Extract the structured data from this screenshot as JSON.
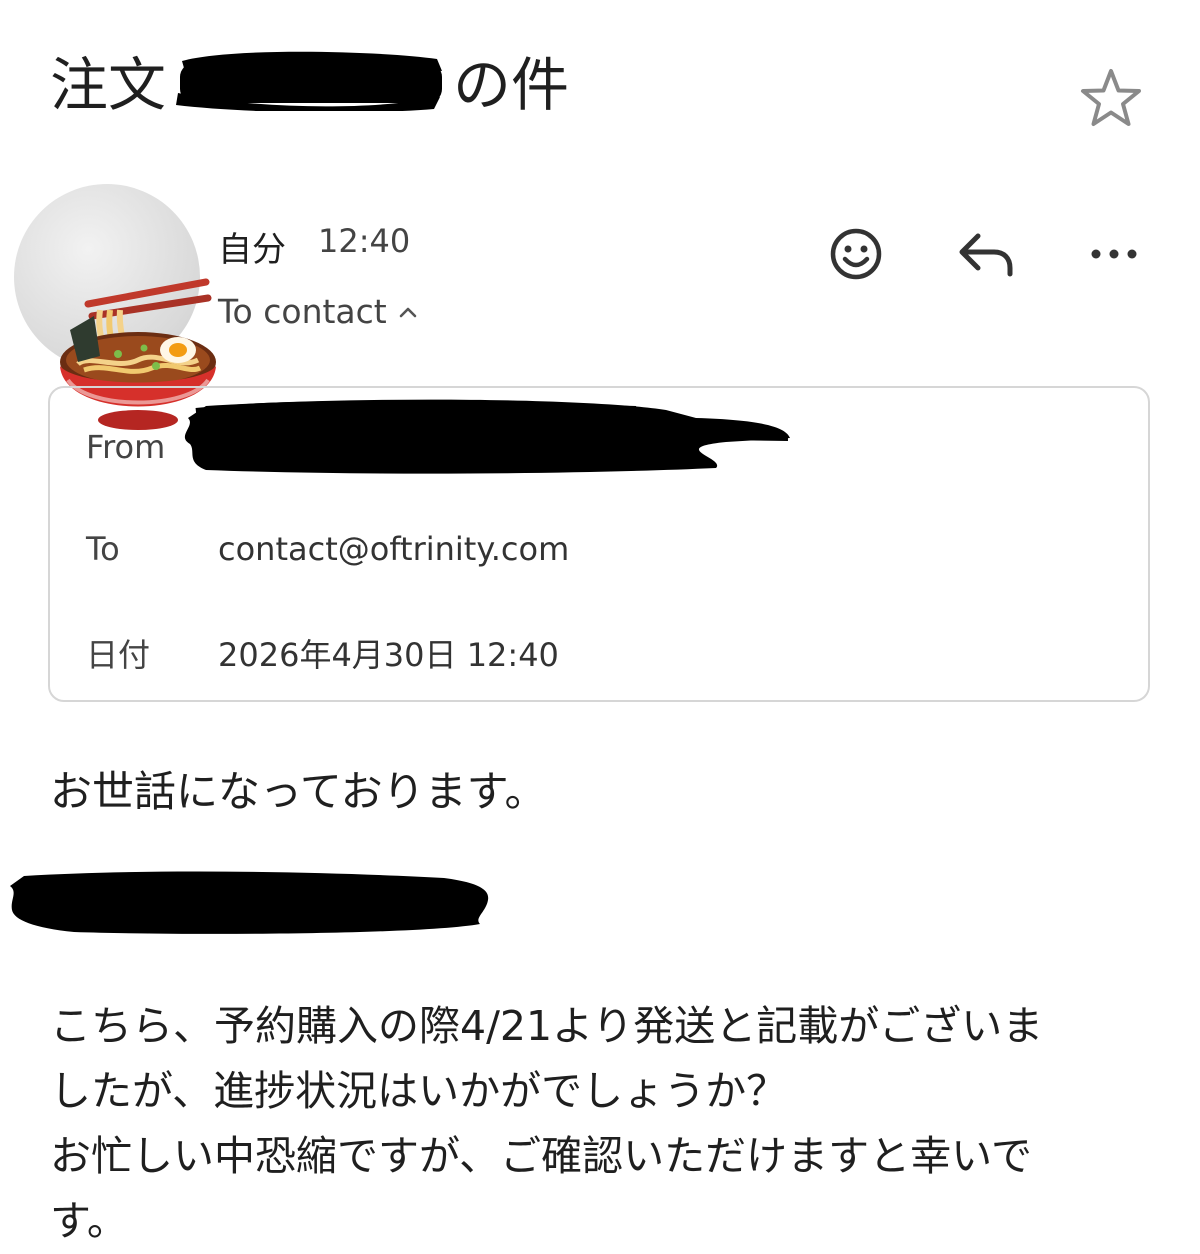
{
  "subject": {
    "prefix": "注文",
    "suffix": "の件",
    "starred": false
  },
  "message": {
    "sender": "自分",
    "time": "12:40",
    "to_summary": "To contact",
    "actions": {
      "emoji_icon": "smiley-icon",
      "reply_icon": "reply-icon",
      "more_icon": "more-horizontal-icon"
    }
  },
  "details": {
    "from_label": "From",
    "to_label": "To",
    "to_value": "contact@oftrinity.com",
    "date_label": "日付",
    "date_value": "2026年4月30日 12:40"
  },
  "body": {
    "greeting": "お世話になっております。",
    "line1": "こちら、予約購入の際4/21より発送と記載がございま",
    "line2": "したが、進捗状況はいかがでしょうか？",
    "line3": "お忙しい中恐縮ですが、ご確認いただけますと幸いで",
    "line4": "す。"
  },
  "colors": {
    "text": "#1f1f1f",
    "muted": "#444444",
    "border": "#d6d6d6",
    "redaction": "#000000"
  }
}
